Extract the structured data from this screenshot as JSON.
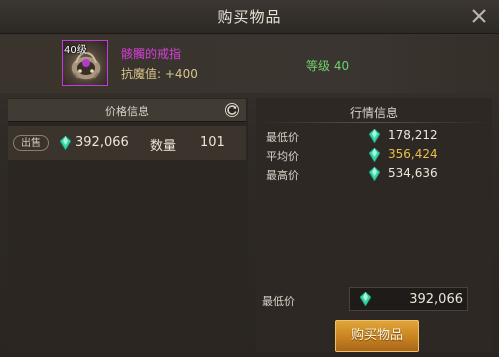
{
  "window": {
    "title": "购买物品"
  },
  "item": {
    "level_tag": "40级",
    "name": "骸髑的戒指",
    "stat_label": "抗魔值:",
    "stat_value": "+400",
    "requirement": "等级 40",
    "icon": "skull-ring-icon",
    "frame_color": "#c03ce0",
    "name_color": "#d63fd9"
  },
  "price_panel": {
    "header": "价格信息",
    "listing": {
      "badge": "出售",
      "price": "392,066",
      "qty_label": "数量",
      "qty_value": "101"
    }
  },
  "market_panel": {
    "header": "行情信息",
    "rows": [
      {
        "label": "最低价",
        "value": "178,212",
        "color": "#ece6da"
      },
      {
        "label": "平均价",
        "value": "356,424",
        "color": "#e8c04a"
      },
      {
        "label": "最高价",
        "value": "534,636",
        "color": "#ece6da"
      }
    ]
  },
  "purchase": {
    "min_price_label": "最低价",
    "min_price_value": "392,066",
    "buy_button": "购买物品",
    "button_color": "#c88320"
  },
  "colors": {
    "gem": "#39d6a8",
    "accent_gold": "#e8c04a",
    "accent_green": "#6fd16a"
  }
}
